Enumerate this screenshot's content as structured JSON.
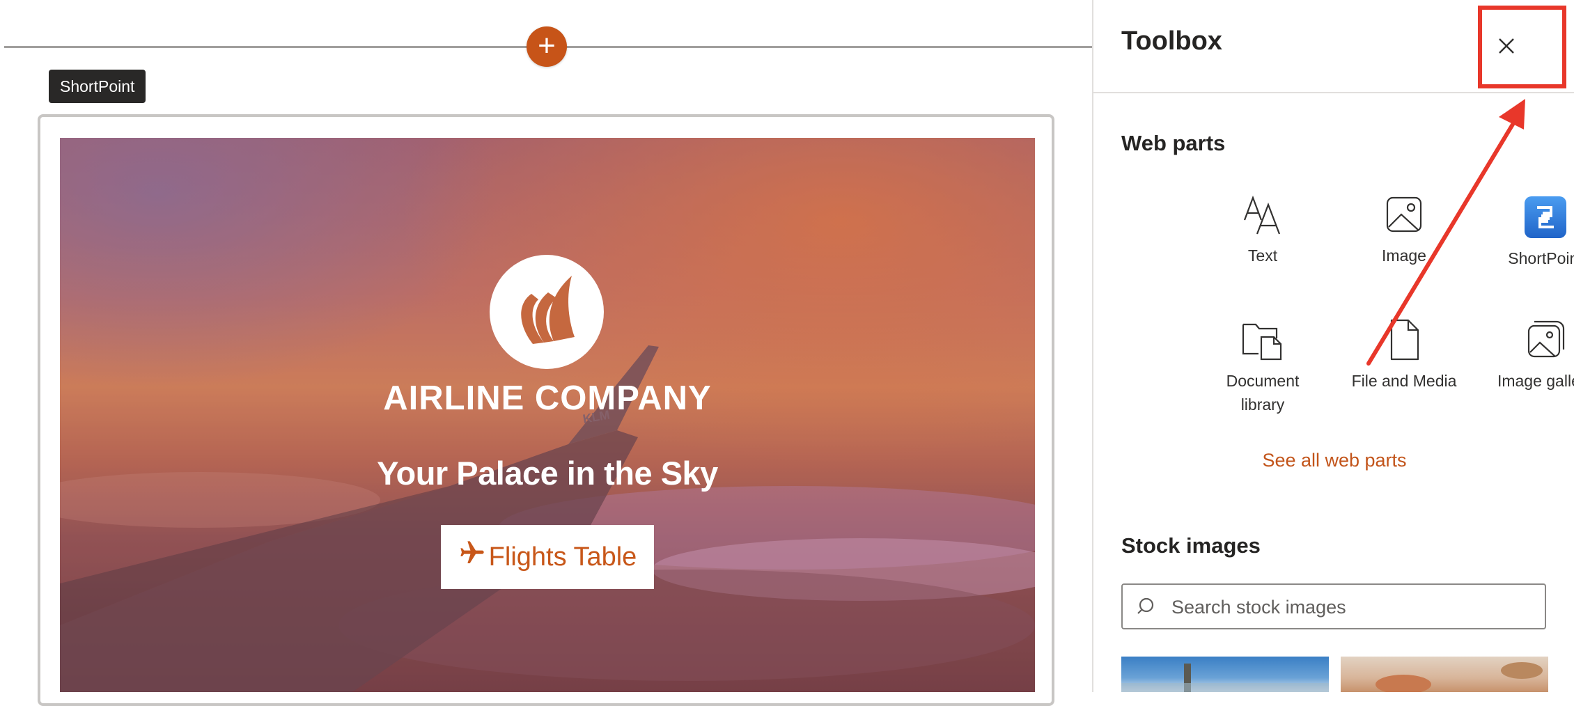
{
  "canvas": {
    "add_section_symbol": "+",
    "webpart_tag": "ShortPoint",
    "hero": {
      "company_name": "AIRLINE COMPANY",
      "tail_text": "KLM",
      "tagline": "Your Palace in the Sky",
      "button_label": "Flights Table",
      "button_icon": "airplane-icon"
    }
  },
  "toolbox": {
    "title": "Toolbox",
    "close_icon": "close-icon",
    "web_parts_heading": "Web parts",
    "web_parts": [
      {
        "label": "Text",
        "icon": "text-icon"
      },
      {
        "label": "Image",
        "icon": "image-icon"
      },
      {
        "label": "ShortPoint",
        "icon": "shortpoint-icon"
      },
      {
        "label": "Document library",
        "icon": "document-library-icon"
      },
      {
        "label": "File and Media",
        "icon": "file-icon"
      },
      {
        "label": "Image gallery",
        "icon": "image-gallery-icon"
      }
    ],
    "see_all_label": "See all web parts",
    "stock_images_heading": "Stock images",
    "search": {
      "placeholder": "Search stock images",
      "value": ""
    }
  },
  "colors": {
    "accent": "#c75418",
    "link": "#c2541a",
    "annotation": "#e8372a",
    "shortpoint_blue": "#2f7fe0"
  }
}
